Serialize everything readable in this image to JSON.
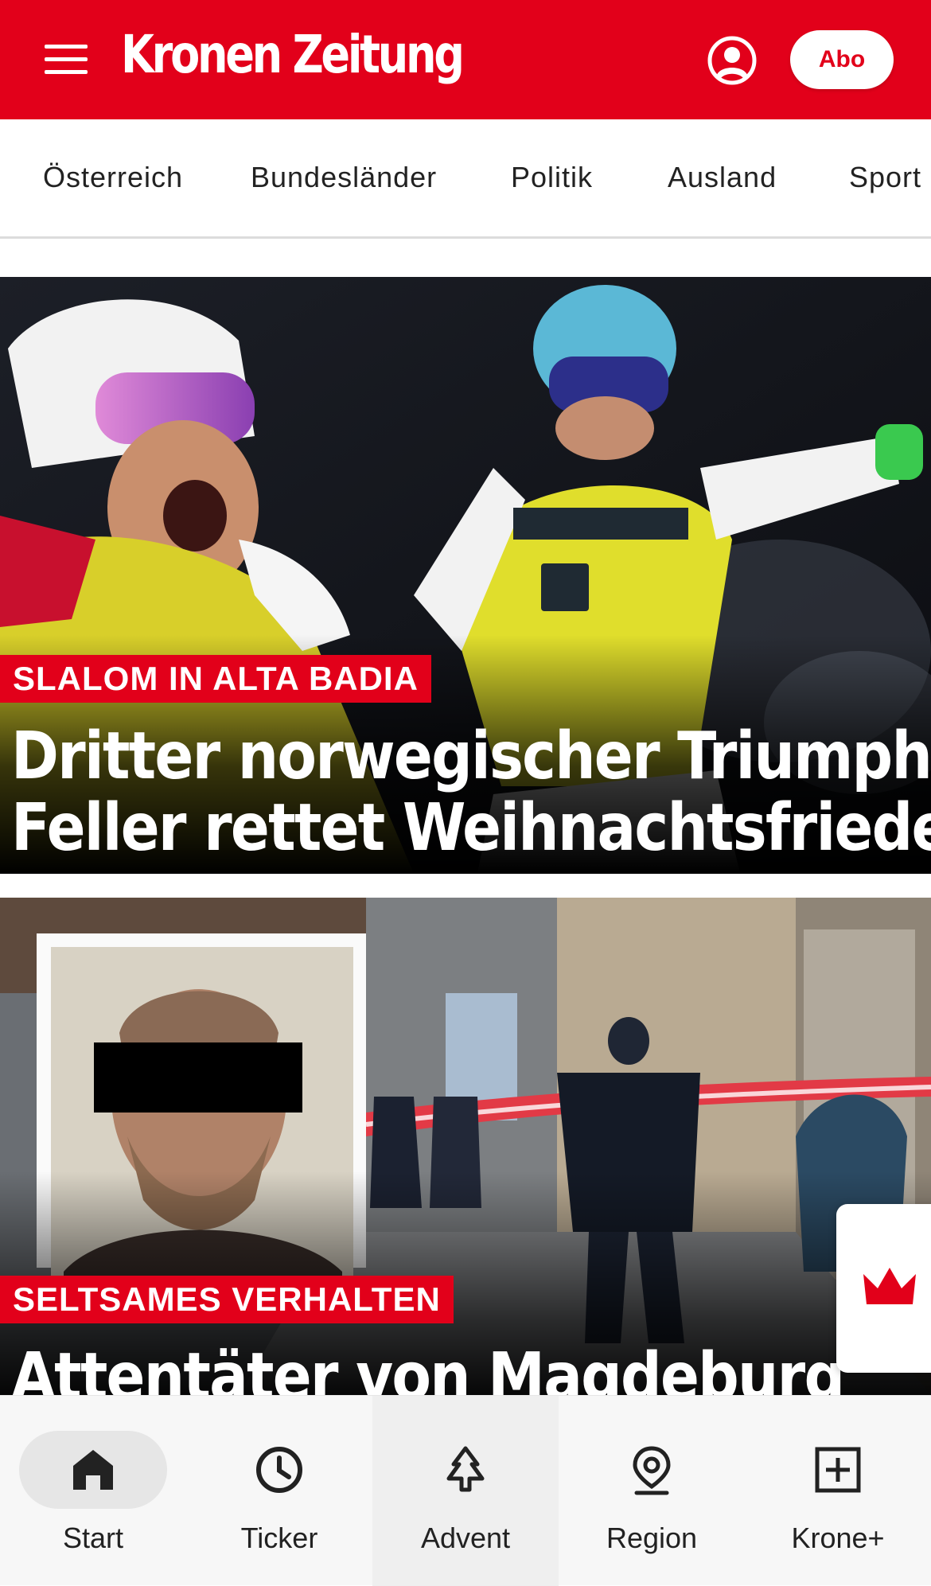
{
  "header": {
    "logo": "Kronen Zeitung",
    "abo_label": "Abo",
    "brand_color": "#e2001a"
  },
  "categories": [
    "Österreich",
    "Bundesländer",
    "Politik",
    "Ausland",
    "Sport"
  ],
  "articles": [
    {
      "kicker": "SLALOM IN ALTA BADIA",
      "headline_line1": "Dritter norwegischer Triumph -",
      "headline_line2": "Feller rettet Weihnachtsfrieden"
    },
    {
      "kicker": "SELTSAMES VERHALTEN",
      "headline_line1": "Attentäter von Magdeburg"
    }
  ],
  "bottom_nav": [
    {
      "label": "Start",
      "icon": "home-icon",
      "active": true
    },
    {
      "label": "Ticker",
      "icon": "clock-icon"
    },
    {
      "label": "Advent",
      "icon": "tree-icon"
    },
    {
      "label": "Region",
      "icon": "location-pin-icon"
    },
    {
      "label": "Krone+",
      "icon": "plus-box-icon"
    }
  ]
}
